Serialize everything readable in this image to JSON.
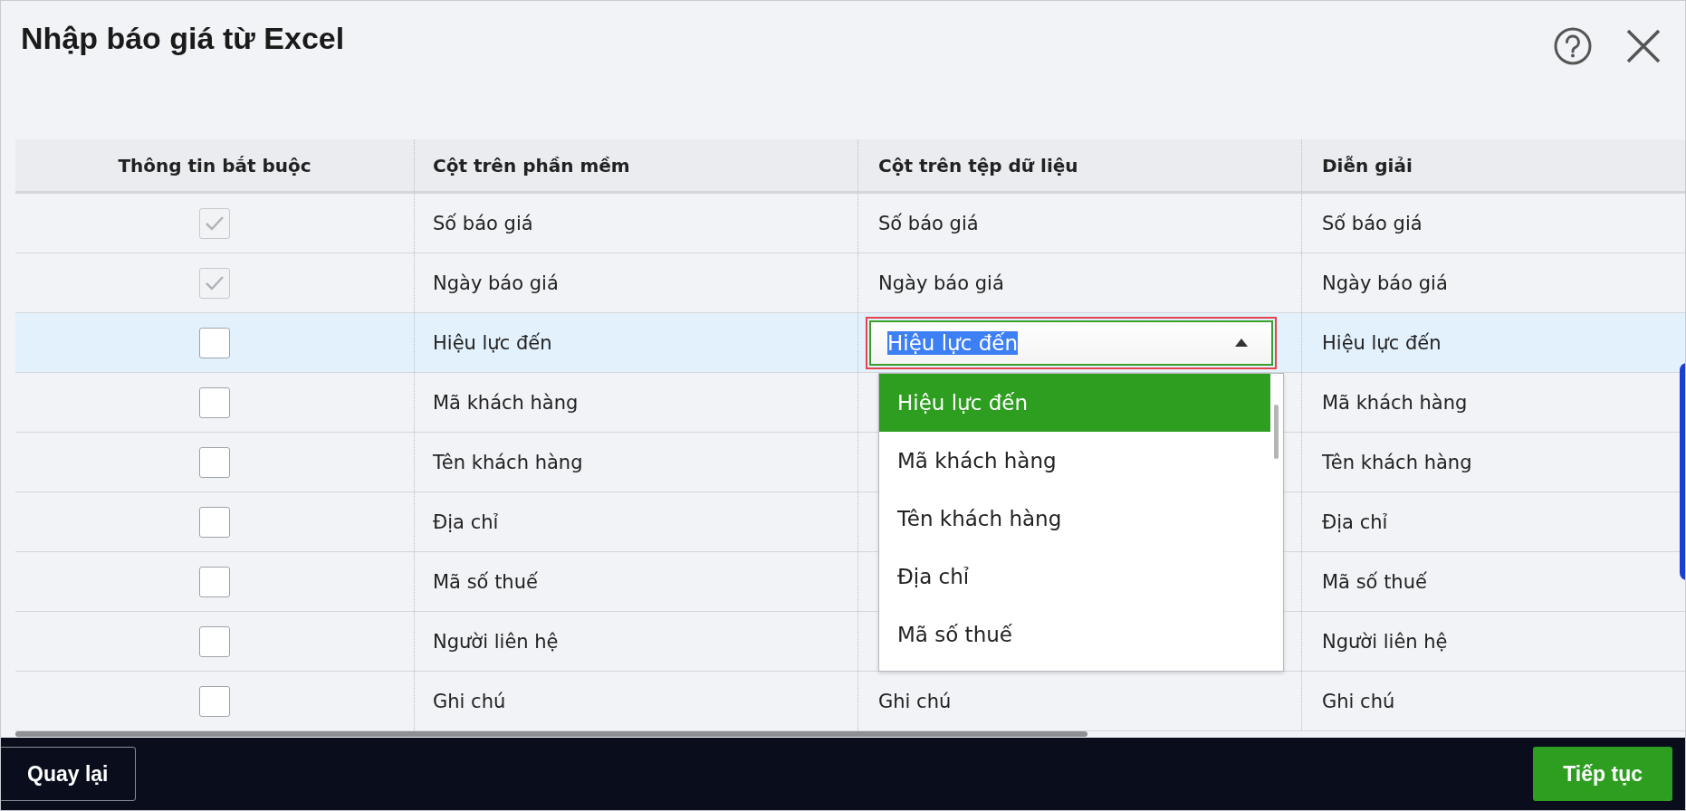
{
  "dialog": {
    "title": "Nhập báo giá từ Excel"
  },
  "table": {
    "columns": [
      "Thông tin bắt buộc",
      "Cột trên phần mềm",
      "Cột trên tệp dữ liệu",
      "Diễn giải"
    ],
    "rows": [
      {
        "required": {
          "checked": true,
          "disabled": true
        },
        "software_column": "Số báo giá",
        "file_column": {
          "kind": "text",
          "value": "Số báo giá"
        },
        "description": "Số báo giá",
        "selected": false
      },
      {
        "required": {
          "checked": true,
          "disabled": true
        },
        "software_column": "Ngày báo giá",
        "file_column": {
          "kind": "text",
          "value": "Ngày báo giá"
        },
        "description": "Ngày báo giá",
        "selected": false
      },
      {
        "required": {
          "checked": false,
          "disabled": false
        },
        "software_column": "Hiệu lực đến",
        "file_column": {
          "kind": "dropdown",
          "value": "Hiệu lực đến",
          "value_highlighted": true,
          "expanded": true,
          "options": [
            {
              "label": "Hiệu lực đến",
              "selected": true
            },
            {
              "label": "Mã khách hàng",
              "selected": false
            },
            {
              "label": "Tên khách hàng",
              "selected": false
            },
            {
              "label": "Địa chỉ",
              "selected": false
            },
            {
              "label": "Mã số thuế",
              "selected": false
            }
          ]
        },
        "description": "Hiệu lực đến",
        "selected": true
      },
      {
        "required": {
          "checked": false,
          "disabled": false
        },
        "software_column": "Mã khách hàng",
        "file_column": {
          "kind": "hidden"
        },
        "description": "Mã khách hàng",
        "selected": false
      },
      {
        "required": {
          "checked": false,
          "disabled": false
        },
        "software_column": "Tên khách hàng",
        "file_column": {
          "kind": "hidden"
        },
        "description": "Tên khách hàng",
        "selected": false
      },
      {
        "required": {
          "checked": false,
          "disabled": false
        },
        "software_column": "Địa chỉ",
        "file_column": {
          "kind": "hidden"
        },
        "description": "Địa chỉ",
        "selected": false
      },
      {
        "required": {
          "checked": false,
          "disabled": false
        },
        "software_column": "Mã số thuế",
        "file_column": {
          "kind": "hidden"
        },
        "description": "Mã số thuế",
        "selected": false
      },
      {
        "required": {
          "checked": false,
          "disabled": false
        },
        "software_column": "Người liên hệ",
        "file_column": {
          "kind": "hidden"
        },
        "description": "Người liên hệ",
        "selected": false
      },
      {
        "required": {
          "checked": false,
          "disabled": false
        },
        "software_column": "Ghi chú",
        "file_column": {
          "kind": "text",
          "value": "Ghi chú"
        },
        "description": "Ghi chú",
        "selected": false
      }
    ]
  },
  "footer": {
    "back_button": "Quay lại",
    "continue_button": "Tiếp tục"
  }
}
